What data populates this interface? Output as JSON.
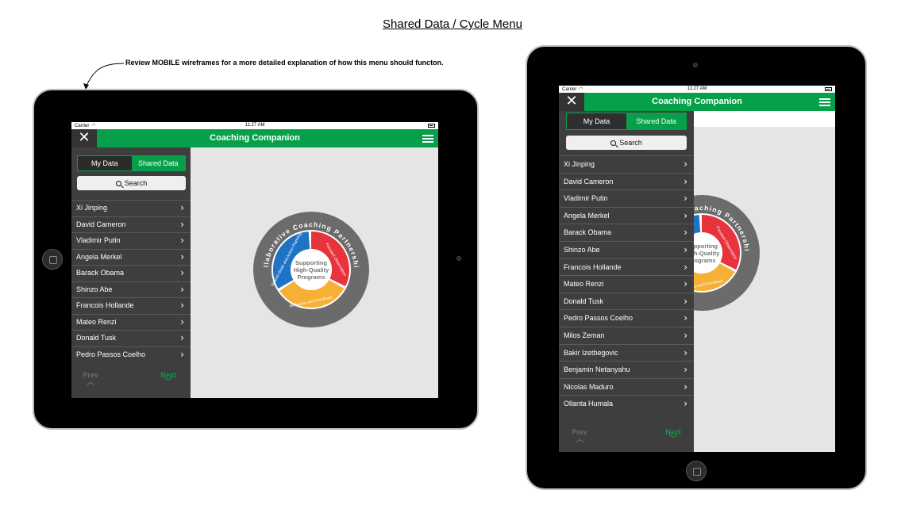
{
  "page_title": "Shared Data / Cycle Menu",
  "annotation": "Review MOBILE wireframes for a more detailed explanation of how this menu should functon.",
  "status": {
    "carrier": "Carrier",
    "time": "11:27 AM"
  },
  "app": {
    "title": "Coaching Companion",
    "close_glyph": "✕"
  },
  "tabs": {
    "my_data": "My Data",
    "shared_data": "Shared Data"
  },
  "search_label": "Search",
  "pager": {
    "prev": "Prev",
    "next": "Next"
  },
  "people": [
    "Xi Jinping",
    "David Cameron",
    "Vladimir Putin",
    "Angela Merkel",
    "Barack Obama",
    "Shinzo Abe",
    "Francois Hollande",
    "Mateo Renzi",
    "Donald Tusk",
    "Pedro Passos Coelho",
    "Milos Zeman",
    "Bakir Izetbegovic",
    "Benjamin Netanyahu",
    "Nicolas Maduro",
    "Ollanta Humala"
  ],
  "wheel": {
    "outer_text": "Collaborative Coaching Partnerships",
    "center_lines": [
      "Supporting",
      "High-Quality",
      "Programs"
    ],
    "seg_blue": "Shared Goals and Action Planning",
    "seg_red": "Focused Observation",
    "seg_yellow": "Reflection and Feedback"
  },
  "colors": {
    "green": "#07a04a",
    "blue": "#1f73c4",
    "red": "#e8323c",
    "yellow": "#f5b035",
    "ring": "#6b6b6b"
  }
}
